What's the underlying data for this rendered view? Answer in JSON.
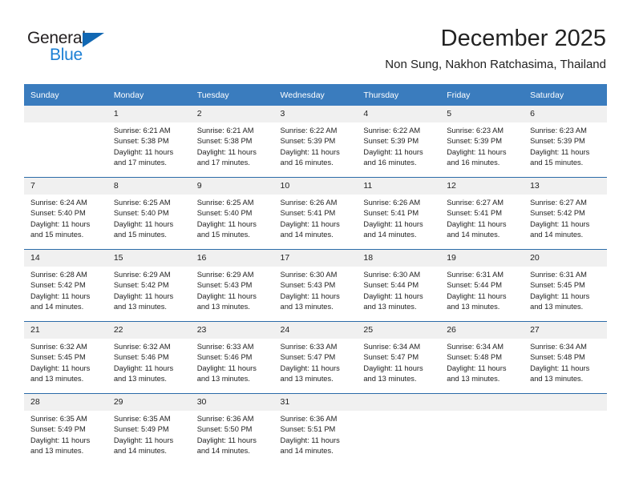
{
  "brand": {
    "name_top": "General",
    "name_bottom": "Blue",
    "triangle_color": "#1268b3",
    "blue_color": "#1b7fd4"
  },
  "header": {
    "month_title": "December 2025",
    "location": "Non Sung, Nakhon Ratchasima, Thailand"
  },
  "theme": {
    "header_bg": "#3a7cbe",
    "week_divider": "#2b6ba8",
    "daynum_bg": "#f0f0f0",
    "text": "#222222"
  },
  "calendar": {
    "weekday_headers": [
      "Sunday",
      "Monday",
      "Tuesday",
      "Wednesday",
      "Thursday",
      "Friday",
      "Saturday"
    ],
    "weeks": [
      [
        {
          "day": "",
          "empty": true,
          "sunrise": "",
          "sunset": "",
          "daylight_line1": "",
          "daylight_line2": ""
        },
        {
          "day": "1",
          "empty": false,
          "sunrise": "Sunrise: 6:21 AM",
          "sunset": "Sunset: 5:38 PM",
          "daylight_line1": "Daylight: 11 hours",
          "daylight_line2": "and 17 minutes."
        },
        {
          "day": "2",
          "empty": false,
          "sunrise": "Sunrise: 6:21 AM",
          "sunset": "Sunset: 5:38 PM",
          "daylight_line1": "Daylight: 11 hours",
          "daylight_line2": "and 17 minutes."
        },
        {
          "day": "3",
          "empty": false,
          "sunrise": "Sunrise: 6:22 AM",
          "sunset": "Sunset: 5:39 PM",
          "daylight_line1": "Daylight: 11 hours",
          "daylight_line2": "and 16 minutes."
        },
        {
          "day": "4",
          "empty": false,
          "sunrise": "Sunrise: 6:22 AM",
          "sunset": "Sunset: 5:39 PM",
          "daylight_line1": "Daylight: 11 hours",
          "daylight_line2": "and 16 minutes."
        },
        {
          "day": "5",
          "empty": false,
          "sunrise": "Sunrise: 6:23 AM",
          "sunset": "Sunset: 5:39 PM",
          "daylight_line1": "Daylight: 11 hours",
          "daylight_line2": "and 16 minutes."
        },
        {
          "day": "6",
          "empty": false,
          "sunrise": "Sunrise: 6:23 AM",
          "sunset": "Sunset: 5:39 PM",
          "daylight_line1": "Daylight: 11 hours",
          "daylight_line2": "and 15 minutes."
        }
      ],
      [
        {
          "day": "7",
          "empty": false,
          "sunrise": "Sunrise: 6:24 AM",
          "sunset": "Sunset: 5:40 PM",
          "daylight_line1": "Daylight: 11 hours",
          "daylight_line2": "and 15 minutes."
        },
        {
          "day": "8",
          "empty": false,
          "sunrise": "Sunrise: 6:25 AM",
          "sunset": "Sunset: 5:40 PM",
          "daylight_line1": "Daylight: 11 hours",
          "daylight_line2": "and 15 minutes."
        },
        {
          "day": "9",
          "empty": false,
          "sunrise": "Sunrise: 6:25 AM",
          "sunset": "Sunset: 5:40 PM",
          "daylight_line1": "Daylight: 11 hours",
          "daylight_line2": "and 15 minutes."
        },
        {
          "day": "10",
          "empty": false,
          "sunrise": "Sunrise: 6:26 AM",
          "sunset": "Sunset: 5:41 PM",
          "daylight_line1": "Daylight: 11 hours",
          "daylight_line2": "and 14 minutes."
        },
        {
          "day": "11",
          "empty": false,
          "sunrise": "Sunrise: 6:26 AM",
          "sunset": "Sunset: 5:41 PM",
          "daylight_line1": "Daylight: 11 hours",
          "daylight_line2": "and 14 minutes."
        },
        {
          "day": "12",
          "empty": false,
          "sunrise": "Sunrise: 6:27 AM",
          "sunset": "Sunset: 5:41 PM",
          "daylight_line1": "Daylight: 11 hours",
          "daylight_line2": "and 14 minutes."
        },
        {
          "day": "13",
          "empty": false,
          "sunrise": "Sunrise: 6:27 AM",
          "sunset": "Sunset: 5:42 PM",
          "daylight_line1": "Daylight: 11 hours",
          "daylight_line2": "and 14 minutes."
        }
      ],
      [
        {
          "day": "14",
          "empty": false,
          "sunrise": "Sunrise: 6:28 AM",
          "sunset": "Sunset: 5:42 PM",
          "daylight_line1": "Daylight: 11 hours",
          "daylight_line2": "and 14 minutes."
        },
        {
          "day": "15",
          "empty": false,
          "sunrise": "Sunrise: 6:29 AM",
          "sunset": "Sunset: 5:42 PM",
          "daylight_line1": "Daylight: 11 hours",
          "daylight_line2": "and 13 minutes."
        },
        {
          "day": "16",
          "empty": false,
          "sunrise": "Sunrise: 6:29 AM",
          "sunset": "Sunset: 5:43 PM",
          "daylight_line1": "Daylight: 11 hours",
          "daylight_line2": "and 13 minutes."
        },
        {
          "day": "17",
          "empty": false,
          "sunrise": "Sunrise: 6:30 AM",
          "sunset": "Sunset: 5:43 PM",
          "daylight_line1": "Daylight: 11 hours",
          "daylight_line2": "and 13 minutes."
        },
        {
          "day": "18",
          "empty": false,
          "sunrise": "Sunrise: 6:30 AM",
          "sunset": "Sunset: 5:44 PM",
          "daylight_line1": "Daylight: 11 hours",
          "daylight_line2": "and 13 minutes."
        },
        {
          "day": "19",
          "empty": false,
          "sunrise": "Sunrise: 6:31 AM",
          "sunset": "Sunset: 5:44 PM",
          "daylight_line1": "Daylight: 11 hours",
          "daylight_line2": "and 13 minutes."
        },
        {
          "day": "20",
          "empty": false,
          "sunrise": "Sunrise: 6:31 AM",
          "sunset": "Sunset: 5:45 PM",
          "daylight_line1": "Daylight: 11 hours",
          "daylight_line2": "and 13 minutes."
        }
      ],
      [
        {
          "day": "21",
          "empty": false,
          "sunrise": "Sunrise: 6:32 AM",
          "sunset": "Sunset: 5:45 PM",
          "daylight_line1": "Daylight: 11 hours",
          "daylight_line2": "and 13 minutes."
        },
        {
          "day": "22",
          "empty": false,
          "sunrise": "Sunrise: 6:32 AM",
          "sunset": "Sunset: 5:46 PM",
          "daylight_line1": "Daylight: 11 hours",
          "daylight_line2": "and 13 minutes."
        },
        {
          "day": "23",
          "empty": false,
          "sunrise": "Sunrise: 6:33 AM",
          "sunset": "Sunset: 5:46 PM",
          "daylight_line1": "Daylight: 11 hours",
          "daylight_line2": "and 13 minutes."
        },
        {
          "day": "24",
          "empty": false,
          "sunrise": "Sunrise: 6:33 AM",
          "sunset": "Sunset: 5:47 PM",
          "daylight_line1": "Daylight: 11 hours",
          "daylight_line2": "and 13 minutes."
        },
        {
          "day": "25",
          "empty": false,
          "sunrise": "Sunrise: 6:34 AM",
          "sunset": "Sunset: 5:47 PM",
          "daylight_line1": "Daylight: 11 hours",
          "daylight_line2": "and 13 minutes."
        },
        {
          "day": "26",
          "empty": false,
          "sunrise": "Sunrise: 6:34 AM",
          "sunset": "Sunset: 5:48 PM",
          "daylight_line1": "Daylight: 11 hours",
          "daylight_line2": "and 13 minutes."
        },
        {
          "day": "27",
          "empty": false,
          "sunrise": "Sunrise: 6:34 AM",
          "sunset": "Sunset: 5:48 PM",
          "daylight_line1": "Daylight: 11 hours",
          "daylight_line2": "and 13 minutes."
        }
      ],
      [
        {
          "day": "28",
          "empty": false,
          "sunrise": "Sunrise: 6:35 AM",
          "sunset": "Sunset: 5:49 PM",
          "daylight_line1": "Daylight: 11 hours",
          "daylight_line2": "and 13 minutes."
        },
        {
          "day": "29",
          "empty": false,
          "sunrise": "Sunrise: 6:35 AM",
          "sunset": "Sunset: 5:49 PM",
          "daylight_line1": "Daylight: 11 hours",
          "daylight_line2": "and 14 minutes."
        },
        {
          "day": "30",
          "empty": false,
          "sunrise": "Sunrise: 6:36 AM",
          "sunset": "Sunset: 5:50 PM",
          "daylight_line1": "Daylight: 11 hours",
          "daylight_line2": "and 14 minutes."
        },
        {
          "day": "31",
          "empty": false,
          "sunrise": "Sunrise: 6:36 AM",
          "sunset": "Sunset: 5:51 PM",
          "daylight_line1": "Daylight: 11 hours",
          "daylight_line2": "and 14 minutes."
        },
        {
          "day": "",
          "empty": true,
          "sunrise": "",
          "sunset": "",
          "daylight_line1": "",
          "daylight_line2": ""
        },
        {
          "day": "",
          "empty": true,
          "sunrise": "",
          "sunset": "",
          "daylight_line1": "",
          "daylight_line2": ""
        },
        {
          "day": "",
          "empty": true,
          "sunrise": "",
          "sunset": "",
          "daylight_line1": "",
          "daylight_line2": ""
        }
      ]
    ]
  }
}
